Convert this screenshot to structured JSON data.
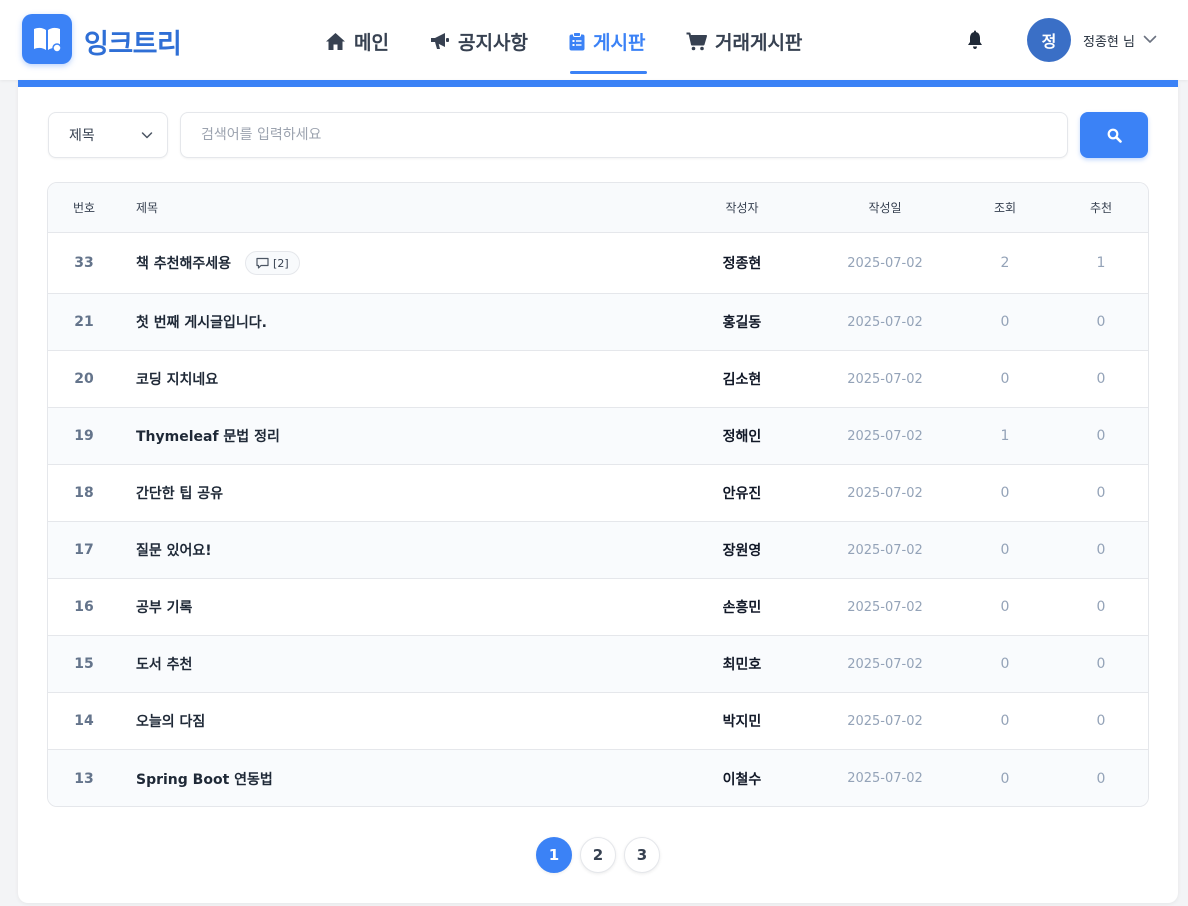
{
  "app": {
    "name": "잉크트리"
  },
  "nav": [
    {
      "label": "메인",
      "icon": "home-icon",
      "active": false
    },
    {
      "label": "공지사항",
      "icon": "megaphone-icon",
      "active": false
    },
    {
      "label": "게시판",
      "icon": "clipboard-icon",
      "active": true
    },
    {
      "label": "거래게시판",
      "icon": "cart-icon",
      "active": false
    }
  ],
  "user": {
    "initial": "정",
    "name": "정종현 님"
  },
  "search": {
    "filter_selected": "제목",
    "placeholder": "검색어를 입력하세요"
  },
  "table": {
    "headers": {
      "num": "번호",
      "title": "제목",
      "author": "작성자",
      "date": "작성일",
      "views": "조회",
      "likes": "추천"
    },
    "rows": [
      {
        "num": "33",
        "title": "책 추천해주세용",
        "comments": "[2]",
        "author": "정종현",
        "date": "2025-07-02",
        "views": "2",
        "likes": "1"
      },
      {
        "num": "21",
        "title": "첫 번째 게시글입니다.",
        "comments": "",
        "author": "홍길동",
        "date": "2025-07-02",
        "views": "0",
        "likes": "0"
      },
      {
        "num": "20",
        "title": "코딩 지치네요",
        "comments": "",
        "author": "김소현",
        "date": "2025-07-02",
        "views": "0",
        "likes": "0"
      },
      {
        "num": "19",
        "title": "Thymeleaf 문법 정리",
        "comments": "",
        "author": "정해인",
        "date": "2025-07-02",
        "views": "1",
        "likes": "0"
      },
      {
        "num": "18",
        "title": "간단한 팁 공유",
        "comments": "",
        "author": "안유진",
        "date": "2025-07-02",
        "views": "0",
        "likes": "0"
      },
      {
        "num": "17",
        "title": "질문 있어요!",
        "comments": "",
        "author": "장원영",
        "date": "2025-07-02",
        "views": "0",
        "likes": "0"
      },
      {
        "num": "16",
        "title": "공부 기록",
        "comments": "",
        "author": "손흥민",
        "date": "2025-07-02",
        "views": "0",
        "likes": "0"
      },
      {
        "num": "15",
        "title": "도서 추천",
        "comments": "",
        "author": "최민호",
        "date": "2025-07-02",
        "views": "0",
        "likes": "0"
      },
      {
        "num": "14",
        "title": "오늘의 다짐",
        "comments": "",
        "author": "박지민",
        "date": "2025-07-02",
        "views": "0",
        "likes": "0"
      },
      {
        "num": "13",
        "title": "Spring Boot 연동법",
        "comments": "",
        "author": "이철수",
        "date": "2025-07-02",
        "views": "0",
        "likes": "0"
      }
    ]
  },
  "pagination": {
    "pages": [
      "1",
      "2",
      "3"
    ],
    "current": "1"
  },
  "colors": {
    "accent": "#3b82f6",
    "brand_text": "#2f6fd6",
    "avatar": "#3a6fc6"
  }
}
